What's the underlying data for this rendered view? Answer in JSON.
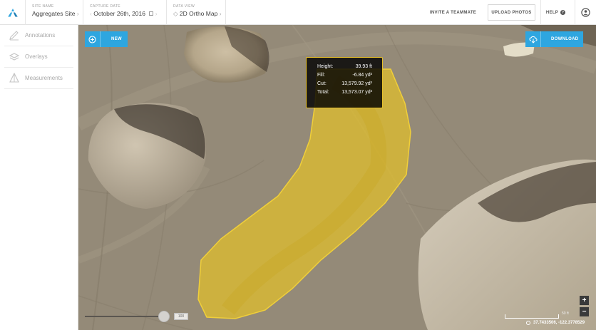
{
  "topbar": {
    "site_name_label": "SITE NAME",
    "site_name_value": "Aggregates Site",
    "capture_date_label": "CAPTURE DATE",
    "capture_date_value": "October 26th, 2016",
    "data_view_label": "DATA VIEW",
    "data_view_value": "2D Ortho Map",
    "invite_label": "INVITE A TEAMMATE",
    "upload_label": "UPLOAD PHOTOS",
    "help_label": "HELP"
  },
  "sidebar": {
    "items": [
      {
        "label": "Annotations",
        "icon": "pen-icon"
      },
      {
        "label": "Overlays",
        "icon": "layers-icon"
      },
      {
        "label": "Measurements",
        "icon": "ruler-icon"
      }
    ]
  },
  "map": {
    "new_label": "NEW",
    "download_label": "DOWNLOAD",
    "measurement": {
      "rows": [
        {
          "key": "Height:",
          "value": "39.93 ft"
        },
        {
          "key": "Fill:",
          "value": "-6.84 yd³"
        },
        {
          "key": "Cut:",
          "value": "13,579.92 yd³"
        },
        {
          "key": "Total:",
          "value": "13,573.07 yd³"
        }
      ],
      "highlight_color": "#e8c12b"
    },
    "slider_value": "100",
    "scale_label": "50 ft",
    "coordinates": "37.7433506, -122.3778529",
    "accent_color": "#2ea6e0"
  }
}
